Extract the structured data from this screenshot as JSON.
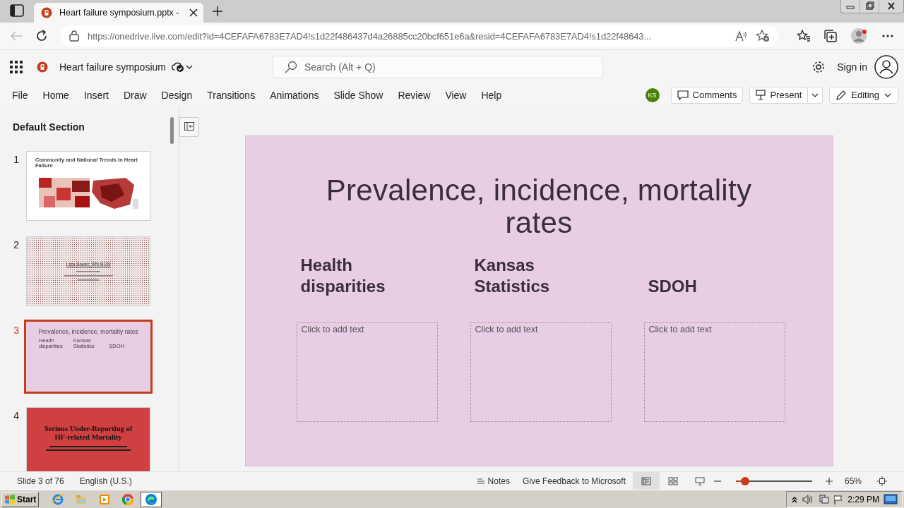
{
  "browser": {
    "tab_title": "Heart failure symposium.pptx -",
    "url": "https://onedrive.live.com/edit?id=4CEFAFA6783E7AD4!s1d22f486437d4a26885cc20bcf651e6a&resid=4CEFAFA6783E7AD4!s1d22f48643..."
  },
  "app": {
    "doc_title": "Heart failure symposium",
    "search": {
      "placeholder": "Search (Alt + Q)"
    },
    "sign_in": "Sign in"
  },
  "ribbon": {
    "menu": [
      "File",
      "Home",
      "Insert",
      "Draw",
      "Design",
      "Transitions",
      "Animations",
      "Slide Show",
      "Review",
      "View",
      "Help"
    ],
    "user_initials": "KS",
    "comments": "Comments",
    "present": "Present",
    "editing": "Editing"
  },
  "slide_pane": {
    "section": "Default Section",
    "slides": [
      {
        "number": "1",
        "selected": false,
        "kind": "map",
        "title": "Community and National Trends in Heart Failure"
      },
      {
        "number": "2",
        "selected": false,
        "kind": "speaker",
        "title": "Lisa Baker, RN BSN"
      },
      {
        "number": "3",
        "selected": true,
        "kind": "columns",
        "title": "Prevalence, incidence, mortality rates",
        "headings": [
          "Health disparities",
          "Kansas Statistics",
          "SDOH"
        ]
      },
      {
        "number": "4",
        "selected": false,
        "kind": "banner",
        "title": "Serious Under-Reporting of HF-related Mortality"
      }
    ]
  },
  "slide": {
    "title": "Prevalence, incidence, mortality rates",
    "columns": [
      {
        "heading": "Health disparities",
        "placeholder": "Click to add text"
      },
      {
        "heading": "Kansas Statistics",
        "placeholder": "Click to add text"
      },
      {
        "heading": "SDOH",
        "placeholder": "Click to add text"
      }
    ]
  },
  "status_bar": {
    "slide_info": "Slide 3 of 76",
    "language": "English (U.S.)",
    "notes": "Notes",
    "feedback": "Give Feedback to Microsoft",
    "views": [
      {
        "kind": "normal",
        "selected": true
      },
      {
        "kind": "sorter",
        "selected": false
      },
      {
        "kind": "reading",
        "selected": false
      }
    ],
    "zoom": {
      "level": 0.12,
      "reading": "65%"
    }
  },
  "taskbar": {
    "start": "Start",
    "clock": "2:29 PM",
    "apps": [
      {
        "kind": "ie",
        "selected": false
      },
      {
        "kind": "folder",
        "selected": false
      },
      {
        "kind": "media",
        "selected": false
      },
      {
        "kind": "chrome",
        "selected": false
      },
      {
        "kind": "edge",
        "selected": true
      }
    ]
  }
}
